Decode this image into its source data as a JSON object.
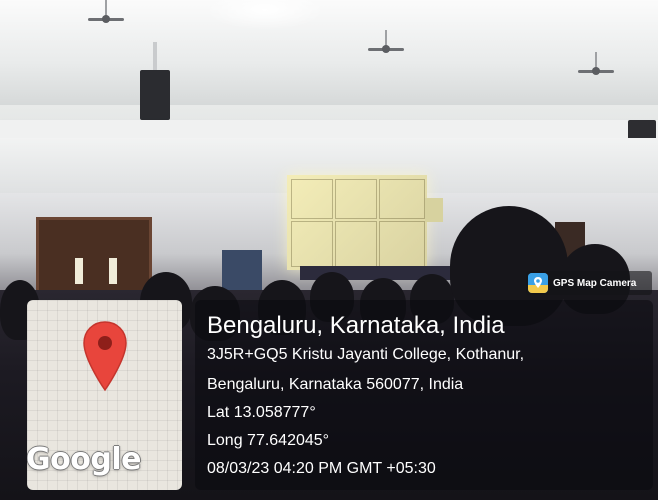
{
  "badge": {
    "label": "GPS Map Camera",
    "icon": "gps-map-camera-icon"
  },
  "map": {
    "logo_text": "Google",
    "pin_icon": "map-pin-icon",
    "pin_color": "#e8453c"
  },
  "location": {
    "title": "Bengaluru, Karnataka, India",
    "address_line1": "3J5R+GQ5 Kristu Jayanti College, Kothanur,",
    "address_line2": "Bengaluru, Karnataka 560077, India",
    "latitude": "Lat 13.058777°",
    "longitude": "Long 77.642045°",
    "datetime": "08/03/23 04:20 PM GMT +05:30"
  }
}
